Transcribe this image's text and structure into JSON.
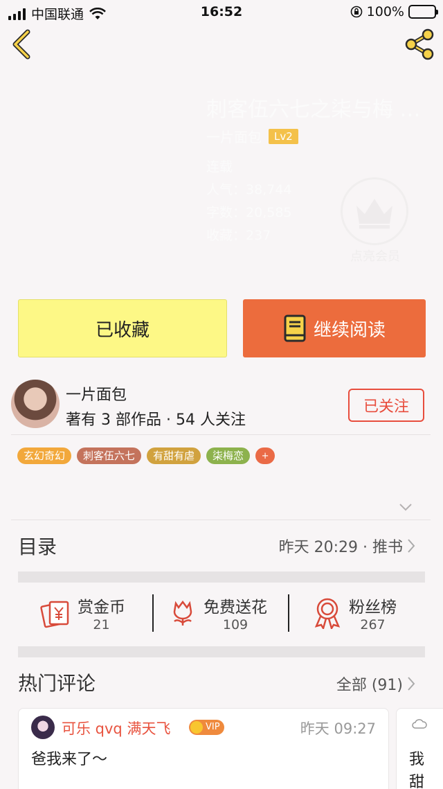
{
  "status_bar": {
    "carrier": "中国联通",
    "time": "16:52",
    "battery": "100%"
  },
  "book": {
    "title": "刺客伍六七之柒与梅 …",
    "author": "一片面包",
    "level": "Lv2",
    "status": "连载",
    "popularity_label": "人气：",
    "popularity": "38,744",
    "words_label": "字数：",
    "words": "20,585",
    "favorites_label": "收藏：",
    "favorites": "237",
    "vip_label": "点亮会员"
  },
  "actions": {
    "favorited_label": "已收藏",
    "continue_label": "继续阅读"
  },
  "author_block": {
    "name": "一片面包",
    "meta": "著有 3 部作品 · 54 人关注",
    "follow_label": "已关注"
  },
  "tags": [
    {
      "label": "玄幻奇幻",
      "color": "#f2a83b"
    },
    {
      "label": "刺客伍六七",
      "color": "#c4735c"
    },
    {
      "label": "有甜有虐",
      "color": "#d1a23e"
    },
    {
      "label": "柒梅恋",
      "color": "#8db24d"
    }
  ],
  "tag_add_label": "+",
  "toc": {
    "label": "目录",
    "update": "昨天 20:29 · 推书"
  },
  "stats": [
    {
      "name": "赏金币",
      "value": "21",
      "icon": "red-envelope-icon"
    },
    {
      "name": "免费送花",
      "value": "109",
      "icon": "flower-icon"
    },
    {
      "name": "粉丝榜",
      "value": "267",
      "icon": "medal-icon"
    }
  ],
  "hot_comments": {
    "label": "热门评论",
    "all_label": "全部 (91)",
    "items": [
      {
        "user": "可乐 qvq 满天飞",
        "vip": "VIP",
        "time": "昨天 09:27",
        "text": "爸我来了～"
      }
    ],
    "next_card_text": [
      "我",
      "甜"
    ]
  },
  "colors": {
    "accent": "#ec6c3d",
    "fav_button": "#fdf886",
    "follow": "#e84d3d"
  }
}
